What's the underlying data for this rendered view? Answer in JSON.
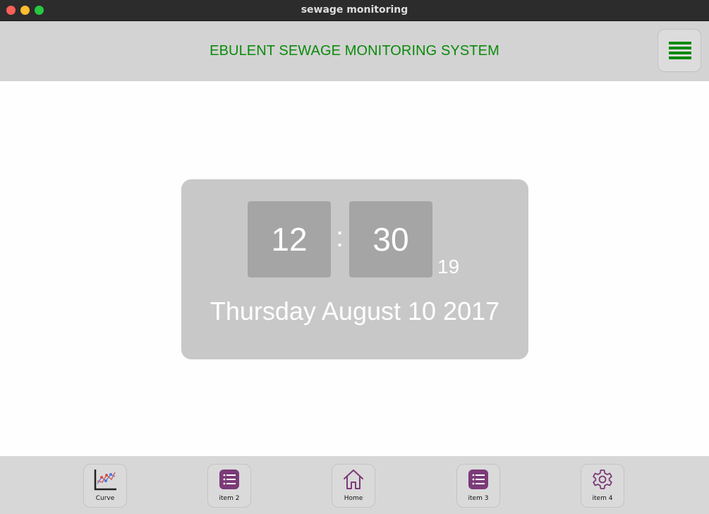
{
  "window": {
    "title": "sewage monitoring"
  },
  "header": {
    "title": "EBULENT SEWAGE MONITORING SYSTEM",
    "menu_icon": "hamburger-menu-icon"
  },
  "clock": {
    "hours": "12",
    "separator": ":",
    "minutes": "30",
    "seconds": "19",
    "date": "Thursday August 10 2017"
  },
  "bottom_nav": [
    {
      "label": "Curve",
      "icon": "line-chart-icon"
    },
    {
      "label": "item 2",
      "icon": "list-icon"
    },
    {
      "label": "Home",
      "icon": "home-icon"
    },
    {
      "label": "item 3",
      "icon": "list-icon"
    },
    {
      "label": "item 4",
      "icon": "gear-icon"
    }
  ],
  "colors": {
    "header_text": "#0a8a0a",
    "menu_icon": "#0a8a0a",
    "nav_icon_purple": "#7b3a78"
  }
}
